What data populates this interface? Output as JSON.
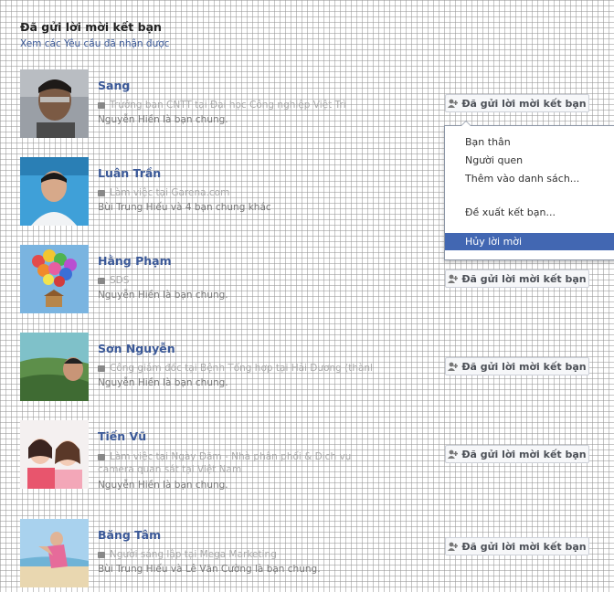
{
  "header": {
    "title": "Đã gửi lời mời kết bạn",
    "link": "Xem các Yêu cầu đã nhận được"
  },
  "button_label": "Đã gửi lời mời kết bạn",
  "friends": [
    {
      "name": "Sang",
      "work": "Trưởng ban CNTT tại Đại học Công nghiệp Việt Trì",
      "mutual": "Nguyễn Hiền là bạn chung."
    },
    {
      "name": "Luân Trần",
      "work": "Làm việc tại Garena.com",
      "mutual": "Bùi Trung Hiếu và 4 bạn chung khác"
    },
    {
      "name": "Hằng Phạm",
      "work": "SDS",
      "mutual": "Nguyễn Hiền là bạn chung."
    },
    {
      "name": "Sơn Nguyễn",
      "work": "Công giám đốc tại Bệnh Tổng hợp tại Hải Dương (thành phố)",
      "mutual": "Nguyễn Hiền là bạn chung."
    },
    {
      "name": "Tiến Vũ",
      "work": "Làm việc tại Ngày Đăm - Nhà phân phối & Dịch vụ camera quan sát tại Việt Nam",
      "mutual": "Nguyễn Hiền là bạn chung."
    },
    {
      "name": "Băng Tâm",
      "work": "Người sáng lập tại Mega Marketing",
      "mutual": "Bùi Trung Hiếu và Lê Văn Cường là bạn chung."
    }
  ],
  "menu": {
    "items": [
      "Bạn thân",
      "Người quen",
      "Thêm vào danh sách...",
      "Đề xuất kết bạn...",
      "Hủy lời mời"
    ],
    "active": "Hủy lời mời"
  },
  "colors": {
    "link": "#3b5998",
    "menu_active": "#4267b2"
  }
}
